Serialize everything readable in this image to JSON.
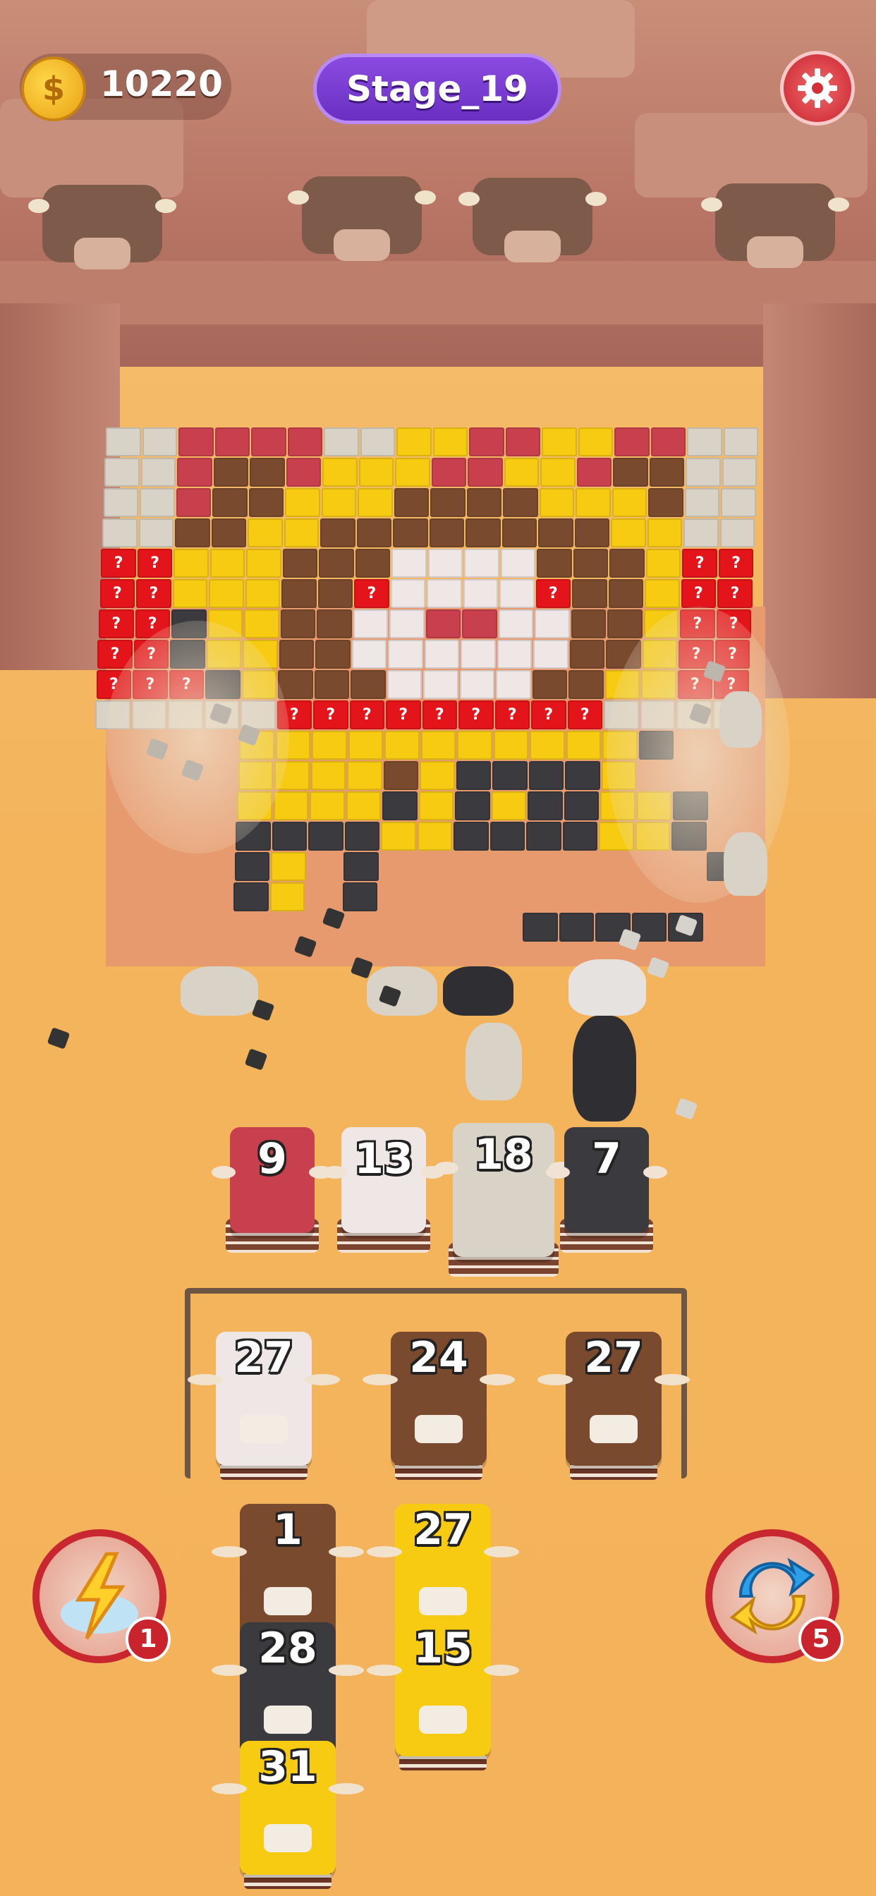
{
  "hud": {
    "coins": "10220",
    "stage": "Stage_19"
  },
  "colors": {
    "red": "#c8404e",
    "white": "#efe6e6",
    "beige": "#d9d2c6",
    "black": "#3a3a3f",
    "brown": "#7a4a2e",
    "yellow": "#f6cb12",
    "question": "#e3141a",
    "floor": "#e69a6d"
  },
  "queue": [
    {
      "count": "9",
      "color": "red"
    },
    {
      "count": "13",
      "color": "white"
    },
    {
      "count": "18",
      "color": "beige"
    },
    {
      "count": "7",
      "color": "black"
    }
  ],
  "pen": [
    {
      "count": "27",
      "color": "white"
    },
    {
      "count": "24",
      "color": "brown"
    },
    {
      "count": "27",
      "color": "brown"
    }
  ],
  "lines": [
    [
      {
        "count": "1",
        "color": "brown"
      },
      {
        "count": "28",
        "color": "black"
      },
      {
        "count": "31",
        "color": "yellow"
      }
    ],
    [
      {
        "count": "27",
        "color": "yellow"
      },
      {
        "count": "15",
        "color": "yellow"
      }
    ]
  ],
  "boosters": {
    "lightning": {
      "icon": "lightning-cloud-icon",
      "count": "1"
    },
    "shuffle": {
      "icon": "shuffle-arrows-icon",
      "count": "5"
    }
  },
  "mystery_mark": "?"
}
